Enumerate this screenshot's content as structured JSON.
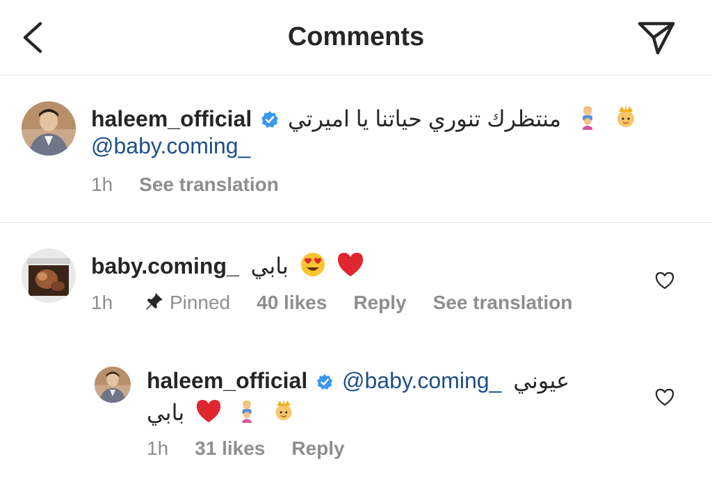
{
  "header": {
    "title": "Comments",
    "back_icon": "chevron-left-icon",
    "send_icon": "paper-plane-icon"
  },
  "comments": [
    {
      "username": "haleem_official",
      "verified": true,
      "text_ar": "منتظرك تنوري حياتنا يا اميرتي",
      "emojis": [
        "woman-with-crown",
        "family-man-girl"
      ],
      "mention": "@baby.coming_",
      "time": "1h",
      "see_translation": "See translation"
    },
    {
      "username": "baby.coming_",
      "verified": false,
      "text_ar": "بابي",
      "emojis": [
        "heart-eyes",
        "red-heart"
      ],
      "time": "1h",
      "pinned": "Pinned",
      "likes": "40 likes",
      "reply": "Reply",
      "see_translation": "See translation"
    }
  ],
  "replies": [
    {
      "username": "haleem_official",
      "verified": true,
      "mention": "@baby.coming_",
      "text_ar": "عيوني",
      "text_ar_2": "بابي",
      "emojis": [
        "red-heart",
        "family-man-girl",
        "woman-with-crown"
      ],
      "time": "1h",
      "likes": "31 likes",
      "reply": "Reply"
    }
  ],
  "colors": {
    "accent_link": "#1d4e89",
    "verified_blue": "#3897f0",
    "meta_gray": "#8e8e8e",
    "heart_red": "#e0262f"
  }
}
